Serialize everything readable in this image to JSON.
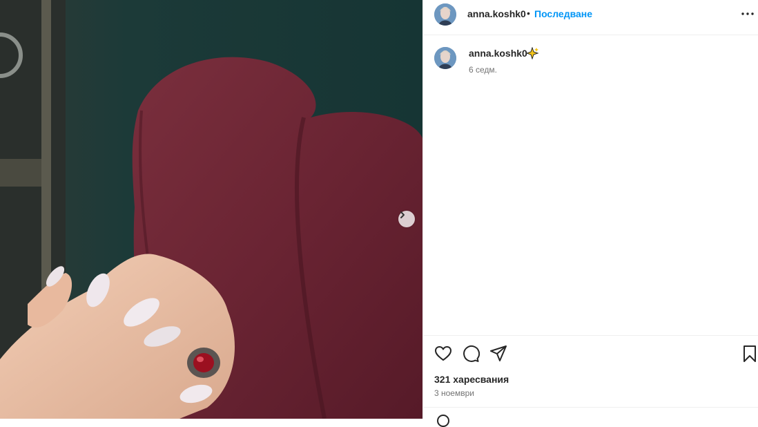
{
  "post": {
    "username": "anna.koshk0",
    "dot": "•",
    "follow_label": "Последване",
    "more_icon": "more-options-icon",
    "caption_username": "anna.koshk0",
    "caption_emoji": "sparkle-icon",
    "time_ago": "6 седм.",
    "likes": "321 харесвания",
    "date": "3 ноември"
  },
  "colors": {
    "accent": "#0095f6",
    "text": "#262626",
    "secondary": "#737373",
    "border": "#efefef"
  }
}
